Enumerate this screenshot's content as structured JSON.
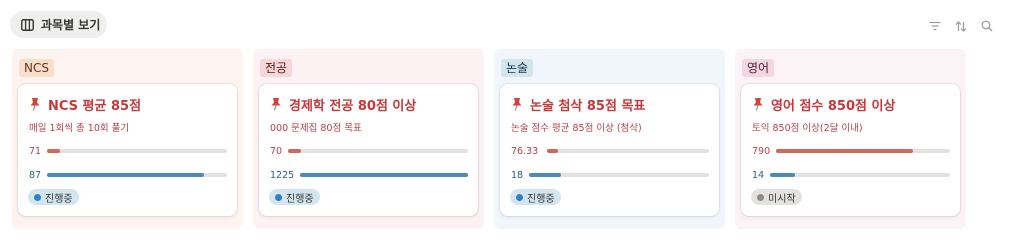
{
  "view_tab": {
    "label": "과목별 보기"
  },
  "toolbar": {
    "filter_icon": "filter-icon",
    "sort_icon": "sort-icon",
    "search_icon": "search-icon"
  },
  "colors": {
    "progress_red": "#d0695a",
    "progress_blue": "#4a8bbd",
    "track": "#e3e2e0",
    "title_red": "#c4393b",
    "status_active_bg": "#d3e5ef",
    "status_active_dot": "#2f80c8",
    "status_idle_bg": "#e3e2e0",
    "status_idle_dot": "#8c8b87"
  },
  "columns": [
    {
      "label": "NCS",
      "label_bg": "#fadec9",
      "label_color": "#5c3b23",
      "col_bg": "#fdf4f1",
      "card": {
        "title": "NCS 평균 85점",
        "description": "매일 1회씩 총 10회 풀기",
        "metric1": {
          "value": "71",
          "fill": 0.07
        },
        "metric2": {
          "value": "87",
          "fill": 0.87
        },
        "status": "진행중",
        "status_type": "active"
      }
    },
    {
      "label": "전공",
      "label_bg": "#f8d7d9",
      "label_color": "#5d1715",
      "col_bg": "#fdf2f3",
      "card": {
        "title": "경제학 전공 80점 이상",
        "description": "000 문제집 80점 목표",
        "metric1": {
          "value": "70",
          "fill": 0.07
        },
        "metric2": {
          "value": "1225",
          "fill": 1.0
        },
        "status": "진행중",
        "status_type": "active"
      }
    },
    {
      "label": "논술",
      "label_bg": "#d3e5ef",
      "label_color": "#183347",
      "col_bg": "#f1f6fd",
      "card": {
        "title": "논술 첨삭 85점 목표",
        "description": "논술 점수 평균 85점 이상 (첨삭)",
        "metric1": {
          "value": "76.33",
          "fill": 0.07
        },
        "metric2": {
          "value": "18",
          "fill": 0.18
        },
        "status": "진행중",
        "status_type": "active"
      }
    },
    {
      "label": "영어",
      "label_bg": "#f5d6e3",
      "label_color": "#4c2337",
      "col_bg": "#fbf3f5",
      "card": {
        "title": "영어 점수 850점 이상",
        "description": "토익 850점 이상(2달 이내)",
        "metric1": {
          "value": "790",
          "fill": 0.79
        },
        "metric2": {
          "value": "14",
          "fill": 0.14
        },
        "status": "미시작",
        "status_type": "idle"
      }
    }
  ]
}
